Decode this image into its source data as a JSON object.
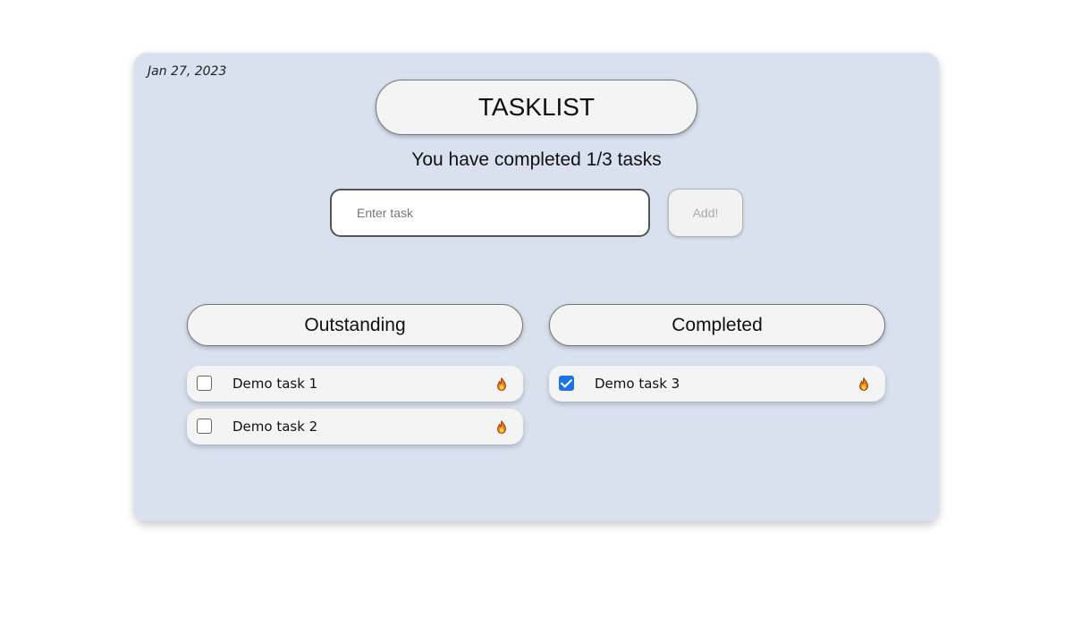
{
  "date": "Jan 27, 2023",
  "title": "TASKLIST",
  "progress_text": "You have completed 1/3 tasks",
  "input": {
    "placeholder": "Enter task",
    "value": ""
  },
  "add_button_label": "Add!",
  "columns": {
    "outstanding": {
      "title": "Outstanding",
      "tasks": [
        {
          "label": "Demo task 1",
          "checked": false,
          "icon": "fire-icon"
        },
        {
          "label": "Demo task 2",
          "checked": false,
          "icon": "fire-icon"
        }
      ]
    },
    "completed": {
      "title": "Completed",
      "tasks": [
        {
          "label": "Demo task 3",
          "checked": true,
          "icon": "fire-icon"
        }
      ]
    }
  },
  "colors": {
    "background": "#d9e0ee",
    "pill": "#f4f4f4",
    "checkbox_checked": "#1a73e8"
  }
}
